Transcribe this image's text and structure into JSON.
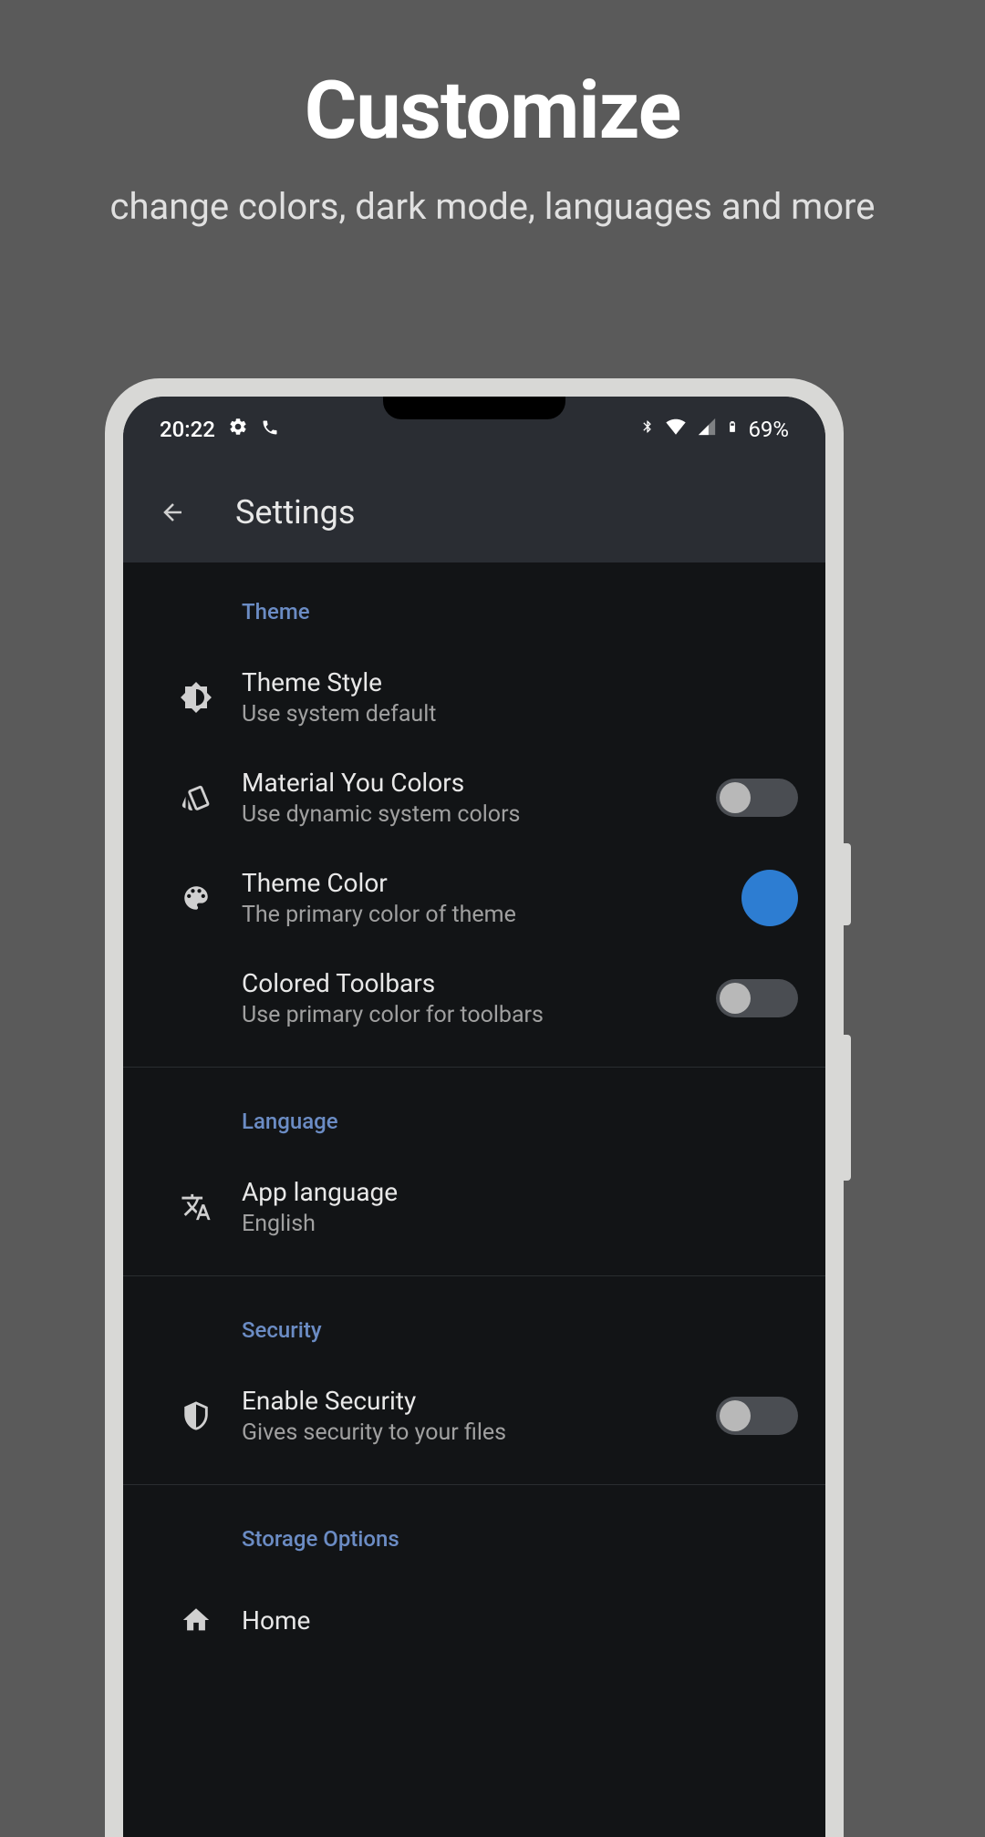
{
  "promo": {
    "title": "Customize",
    "subtitle": "change colors, dark mode, languages and more"
  },
  "statusBar": {
    "time": "20:22",
    "battery": "69%"
  },
  "appBar": {
    "title": "Settings"
  },
  "sections": {
    "theme": {
      "header": "Theme",
      "themeStyle": {
        "title": "Theme Style",
        "subtitle": "Use system default"
      },
      "materialYou": {
        "title": "Material You Colors",
        "subtitle": "Use dynamic system colors",
        "enabled": false
      },
      "themeColor": {
        "title": "Theme Color",
        "subtitle": "The primary color of theme",
        "color": "#2d7dd2"
      },
      "coloredToolbars": {
        "title": "Colored Toolbars",
        "subtitle": "Use primary color for toolbars",
        "enabled": false
      }
    },
    "language": {
      "header": "Language",
      "appLanguage": {
        "title": "App language",
        "subtitle": "English"
      }
    },
    "security": {
      "header": "Security",
      "enableSecurity": {
        "title": "Enable Security",
        "subtitle": "Gives security to your files",
        "enabled": false
      }
    },
    "storage": {
      "header": "Storage Options",
      "home": {
        "title": "Home"
      }
    }
  }
}
